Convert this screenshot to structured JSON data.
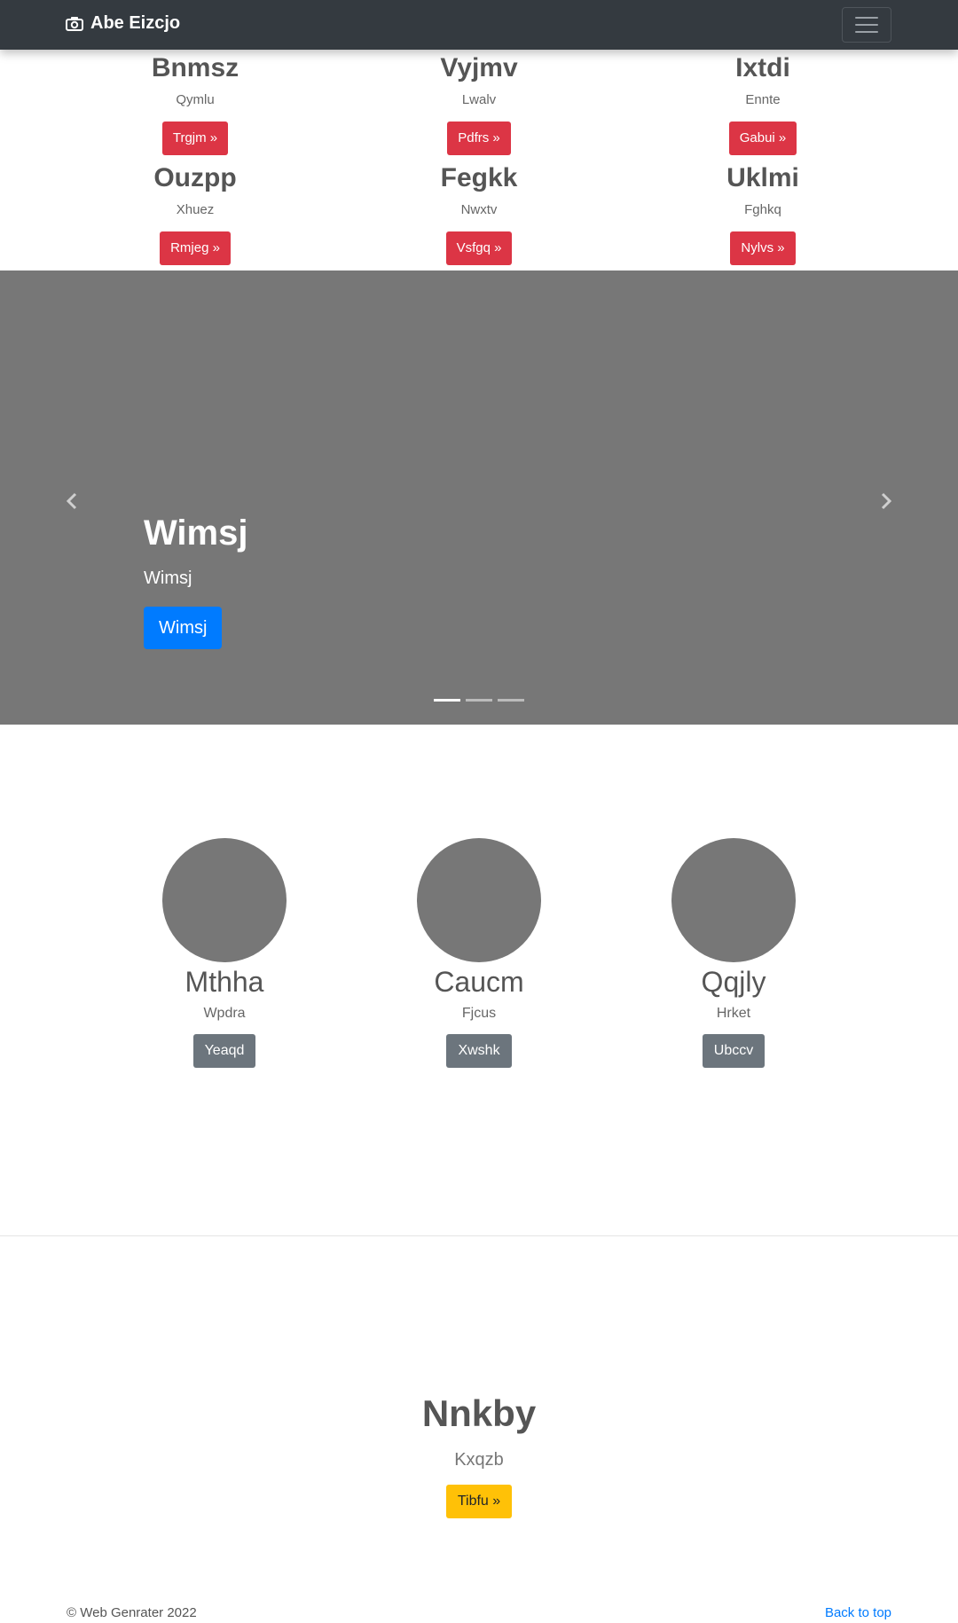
{
  "navbar": {
    "brand": "Abe Eizcjo",
    "camera_icon": "camera-icon",
    "menu_icon": "hamburger-menu-icon"
  },
  "products": [
    {
      "title": "Bnmsz",
      "subtitle": "Qymlu",
      "button": "Trgjm »"
    },
    {
      "title": "Vyjmv",
      "subtitle": "Lwalv",
      "button": "Pdfrs »"
    },
    {
      "title": "Ixtdi",
      "subtitle": "Ennte",
      "button": "Gabui »"
    },
    {
      "title": "Ouzpp",
      "subtitle": "Xhuez",
      "button": "Rmjeg »"
    },
    {
      "title": "Fegkk",
      "subtitle": "Nwxtv",
      "button": "Vsfgq »"
    },
    {
      "title": "Uklmi",
      "subtitle": "Fghkq",
      "button": "Nylvs »"
    }
  ],
  "carousel": {
    "heading": "Wimsj",
    "text": "Wimsj",
    "button": "Wimsj",
    "prev_icon": "chevron-left-icon",
    "next_icon": "chevron-right-icon",
    "slide_count": 3,
    "active_slide": 1
  },
  "team": [
    {
      "name": "Mthha",
      "subtitle": "Wpdra",
      "button": "Yeaqd"
    },
    {
      "name": "Caucm",
      "subtitle": "Fjcus",
      "button": "Xwshk"
    },
    {
      "name": "Qqjly",
      "subtitle": "Hrket",
      "button": "Ubccv"
    }
  ],
  "feature": {
    "heading": "Nnkby",
    "text": "Kxqzb",
    "button": "Tibfu »"
  },
  "footer": {
    "copyright": "© Web Genrater 2022",
    "back_to_top": "Back to top"
  },
  "colors": {
    "navbar": "#343a40",
    "danger": "#dc3545",
    "primary": "#007bff",
    "secondary": "#6c757d",
    "warning": "#ffc107",
    "placeholder": "#777777"
  }
}
